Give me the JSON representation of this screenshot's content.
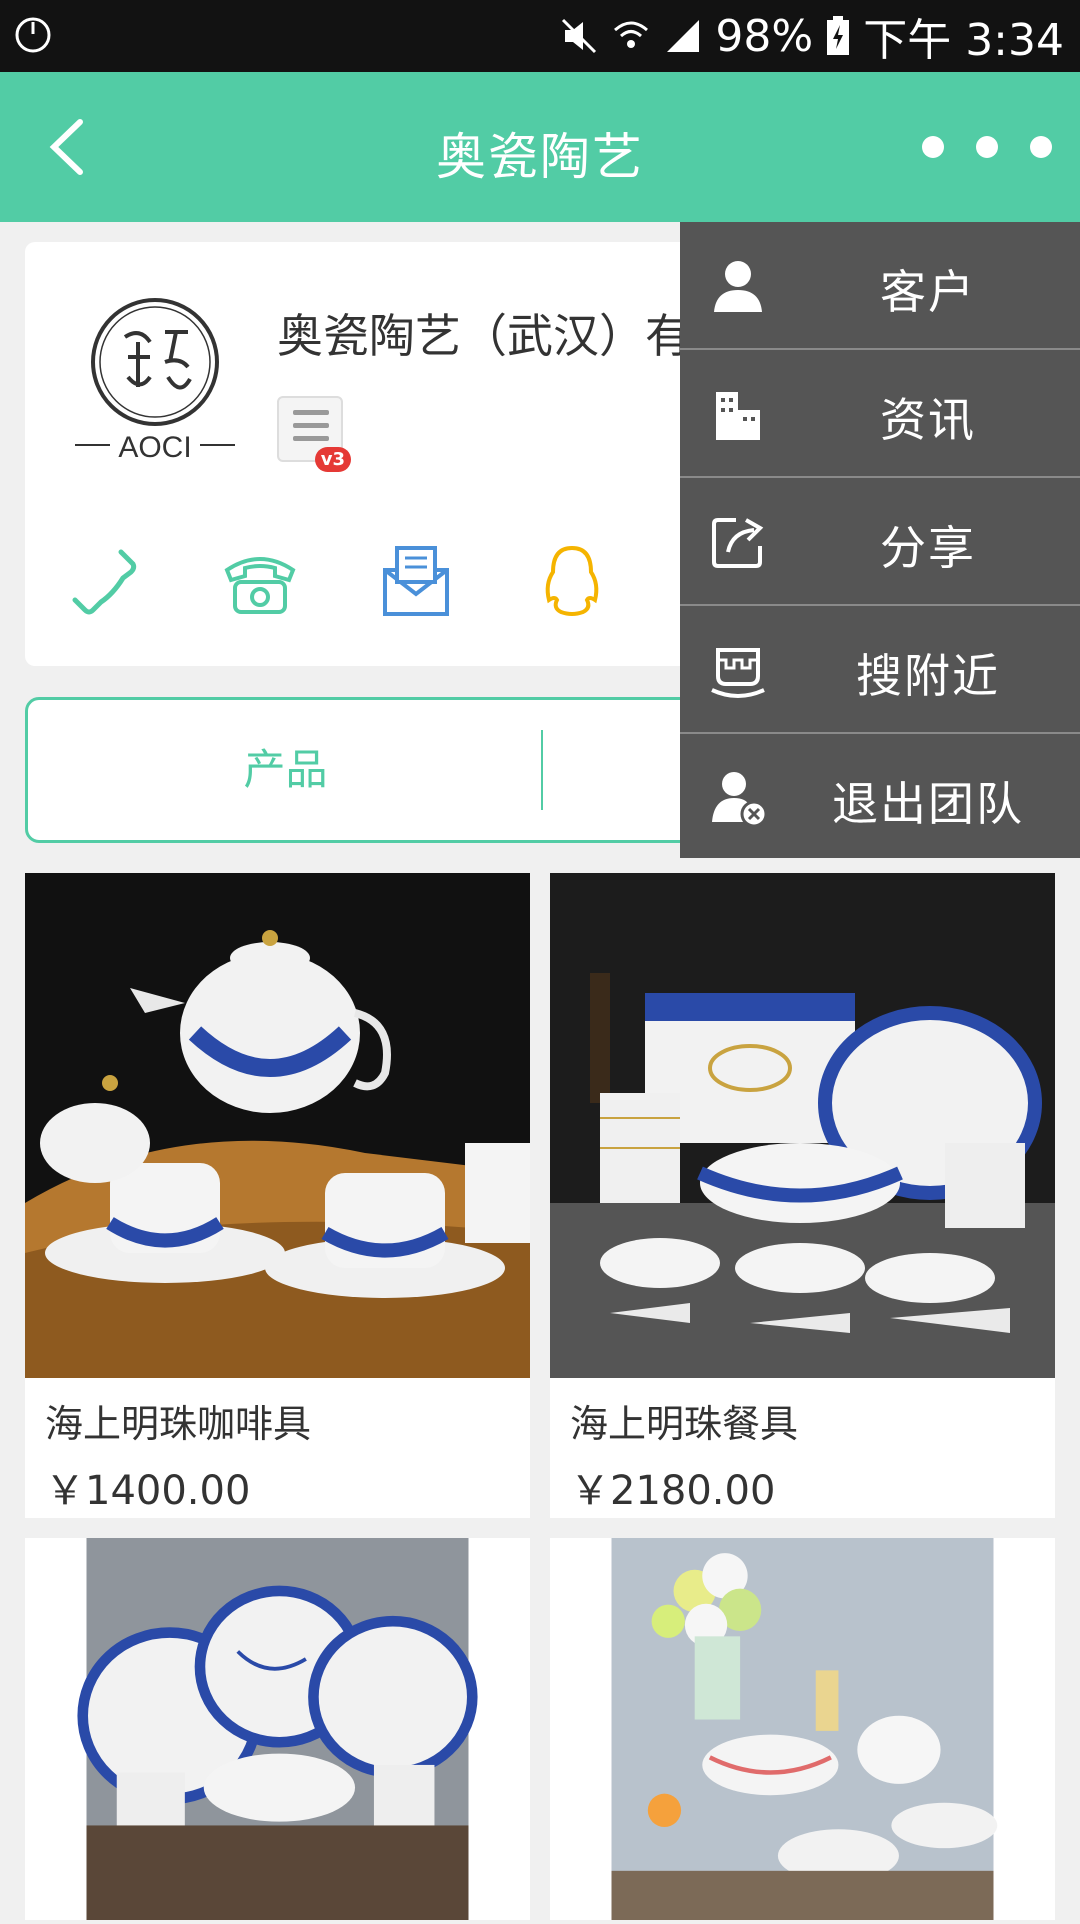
{
  "status_bar": {
    "battery": "98%",
    "time": "下午 3:34"
  },
  "app_bar": {
    "title": "奥瓷陶艺"
  },
  "company": {
    "name": "奥瓷陶艺（武汉）有",
    "logo_text": "AOCI",
    "badge": "v3"
  },
  "tabs": {
    "products": "产品"
  },
  "products": [
    {
      "name": "海上明珠咖啡具",
      "price": "￥1400.00"
    },
    {
      "name": "海上明珠餐具",
      "price": "￥2180.00"
    }
  ],
  "menu": {
    "items": [
      {
        "label": "客户",
        "icon": "user-icon"
      },
      {
        "label": "资讯",
        "icon": "buildings-icon"
      },
      {
        "label": "分享",
        "icon": "share-icon"
      },
      {
        "label": "搜附近",
        "icon": "nearby-icon"
      },
      {
        "label": "退出团队",
        "icon": "leave-team-icon"
      }
    ]
  },
  "colors": {
    "accent": "#52cca5",
    "menu_bg": "#555555",
    "phone": "#52cca5",
    "email": "#4a90d9",
    "qq": "#f5b400"
  }
}
